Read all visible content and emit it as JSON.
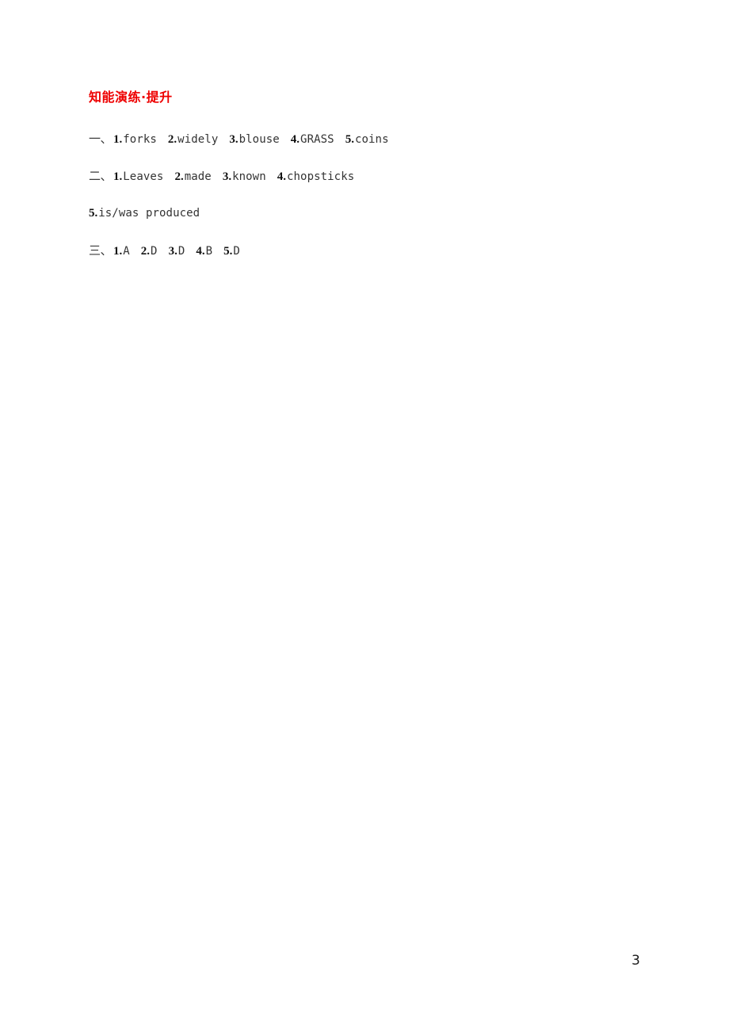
{
  "document": {
    "section_title": "知能演练·提升",
    "section_title_color": "#ee0000",
    "page_number": "3",
    "answers": [
      {
        "marker": "一、",
        "items": [
          {
            "num": "1.",
            "value": "forks"
          },
          {
            "num": "2.",
            "value": "widely"
          },
          {
            "num": "3.",
            "value": "blouse"
          },
          {
            "num": "4.",
            "value": "GRASS"
          },
          {
            "num": "5.",
            "value": "coins"
          }
        ]
      },
      {
        "marker": "二、",
        "items": [
          {
            "num": "1.",
            "value": "Leaves"
          },
          {
            "num": "2.",
            "value": "made"
          },
          {
            "num": "3.",
            "value": "known"
          },
          {
            "num": "4.",
            "value": "chopsticks"
          }
        ]
      },
      {
        "marker": "",
        "items": [
          {
            "num": "5.",
            "value": "is/was produced"
          }
        ]
      },
      {
        "marker": "三、",
        "items": [
          {
            "num": "1.",
            "value": "A"
          },
          {
            "num": "2.",
            "value": "D"
          },
          {
            "num": "3.",
            "value": "D"
          },
          {
            "num": "4.",
            "value": "B"
          },
          {
            "num": "5.",
            "value": "D"
          }
        ]
      }
    ]
  }
}
